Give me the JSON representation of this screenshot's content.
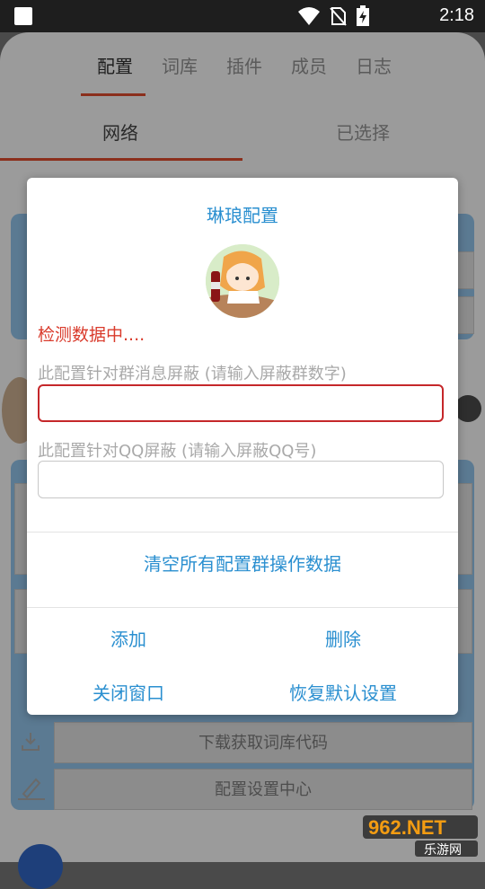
{
  "status_bar": {
    "time": "2:18",
    "icons": [
      "wifi-icon",
      "no-sim-icon",
      "battery-charging-icon"
    ]
  },
  "background": {
    "tabs": [
      "配置",
      "词库",
      "插件",
      "成员",
      "日志"
    ],
    "active_tab": "配置",
    "subtabs": [
      "网络",
      "已选择"
    ],
    "rows": [
      "下载获取词库代码",
      "配置设置中心"
    ]
  },
  "dialog": {
    "title": "琳琅配置",
    "status_text": "检测数据中....",
    "group_field": {
      "label": "此配置针对群消息屏蔽 (请输入屏蔽群数字)",
      "value": ""
    },
    "qq_field": {
      "label": "此配置针对QQ屏蔽 (请输入屏蔽QQ号)",
      "value": ""
    },
    "clear_button": "清空所有配置群操作数据",
    "add_button": "添加",
    "delete_button": "删除",
    "close_button": "关闭窗口",
    "restore_button": "恢复默认设置"
  },
  "watermark": {
    "top": "962.NET",
    "bottom": "乐游网"
  },
  "colors": {
    "accent": "#2a8fd0",
    "error": "#d93a2b",
    "tab_underline": "#8b2f1c"
  }
}
